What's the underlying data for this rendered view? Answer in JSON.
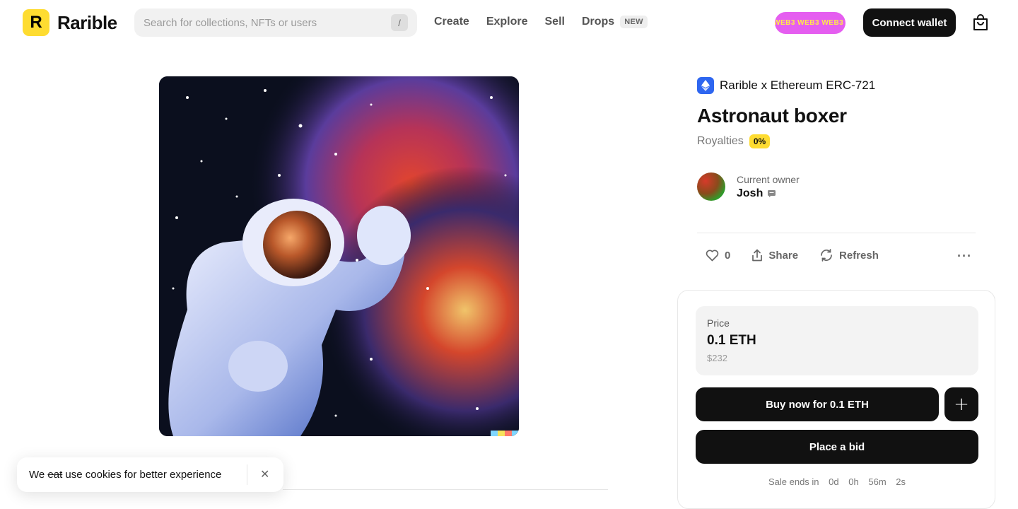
{
  "brand": {
    "logo_letter": "R",
    "name": "Rarible",
    "accent": "#fedc31"
  },
  "search": {
    "placeholder": "Search for collections, NFTs or users",
    "shortcut": "/"
  },
  "nav": {
    "create": "Create",
    "explore": "Explore",
    "sell": "Sell",
    "drops": "Drops",
    "drops_badge": "NEW"
  },
  "promo": {
    "text": "WEB3 WEB3 WEB3 WEB3"
  },
  "header": {
    "connect_wallet": "Connect wallet",
    "cart_icon": "shopping-bag-icon"
  },
  "item": {
    "collection": "Rarible x Ethereum ERC-721",
    "title": "Astronaut boxer",
    "royalties_label": "Royalties",
    "royalties_value": "0%",
    "owner_label": "Current owner",
    "owner_name": "Josh",
    "likes": "0",
    "share": "Share",
    "refresh": "Refresh",
    "more": "···"
  },
  "sale": {
    "price_label": "Price",
    "price_value": "0.1 ETH",
    "price_usd": "$232",
    "buy_label": "Buy now for 0.1 ETH",
    "plus": "+",
    "bid_label": "Place a bid",
    "ends_label": "Sale ends in",
    "days": "0d",
    "hours": "0h",
    "minutes": "56m",
    "seconds": "2s"
  },
  "cookie": {
    "before": "We ",
    "struck": "eat",
    "after": " use cookies for better experience",
    "close": "✕"
  }
}
